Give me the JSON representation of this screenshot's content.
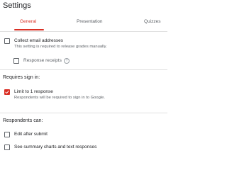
{
  "page": {
    "title": "Settings"
  },
  "tabs": [
    {
      "label": "General",
      "active": true
    },
    {
      "label": "Presentation",
      "active": false
    },
    {
      "label": "Quizzes",
      "active": false
    }
  ],
  "general": {
    "collect_email": {
      "label": "Collect email addresses",
      "description": "This setting is required to release grades manually.",
      "checked": false
    },
    "response_receipts": {
      "label": "Response receipts",
      "checked": false
    }
  },
  "requires_sign_in": {
    "heading": "Requires sign in:",
    "limit_one": {
      "label": "Limit to 1 response",
      "description": "Respondents will be required to sign in to Google.",
      "checked": true
    }
  },
  "respondents_can": {
    "heading": "Respondents can:",
    "edit_after_submit": {
      "label": "Edit after submit",
      "checked": false
    },
    "see_summary": {
      "label": "See summary charts and text responses",
      "checked": false
    }
  },
  "colors": {
    "accent": "#d93025",
    "text": "#202124",
    "muted": "#5f6368",
    "divider": "#e0e0e0"
  },
  "icons": {
    "help": "help-circle-icon",
    "check": "check-icon"
  }
}
